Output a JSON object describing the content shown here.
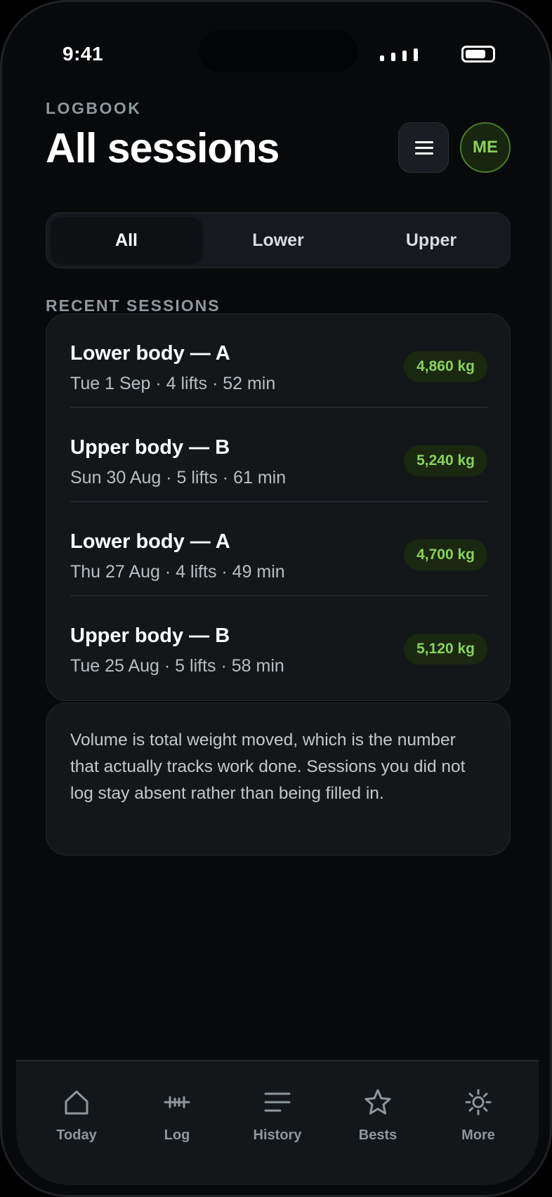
{
  "status_bar": {
    "time": "9:41"
  },
  "header": {
    "eyebrow": "LOGBOOK",
    "title": "All sessions",
    "avatar_initials": "ME"
  },
  "filter": {
    "segments": [
      {
        "label": "All",
        "selected": true
      },
      {
        "label": "Lower",
        "selected": false
      },
      {
        "label": "Upper",
        "selected": false
      }
    ]
  },
  "recent": {
    "section_label": "RECENT SESSIONS",
    "sessions": [
      {
        "title": "Lower body — A",
        "meta": "Tue 1 Sep · 4 lifts · 52 min",
        "volume": "4,860 kg"
      },
      {
        "title": "Upper body — B",
        "meta": "Sun 30 Aug · 5 lifts · 61 min",
        "volume": "5,240 kg"
      },
      {
        "title": "Lower body — A",
        "meta": "Thu 27 Aug · 4 lifts · 49 min",
        "volume": "4,700 kg"
      },
      {
        "title": "Upper body — B",
        "meta": "Tue 25 Aug · 5 lifts · 58 min",
        "volume": "5,120 kg"
      }
    ]
  },
  "info": {
    "text": "Volume is total weight moved, which is the number that actually tracks work done. Sessions you did not log stay absent rather than being filled in."
  },
  "tab_bar": {
    "tabs": [
      {
        "label": "Today",
        "icon": "home-icon"
      },
      {
        "label": "Log",
        "icon": "dumbbell-icon"
      },
      {
        "label": "History",
        "icon": "list-icon"
      },
      {
        "label": "Bests",
        "icon": "star-icon"
      },
      {
        "label": "More",
        "icon": "sun-icon"
      }
    ]
  },
  "colors": {
    "background": "#07090b",
    "card": "#14171a",
    "accent_green": "#8ad15a",
    "muted_text": "#8e979c"
  }
}
